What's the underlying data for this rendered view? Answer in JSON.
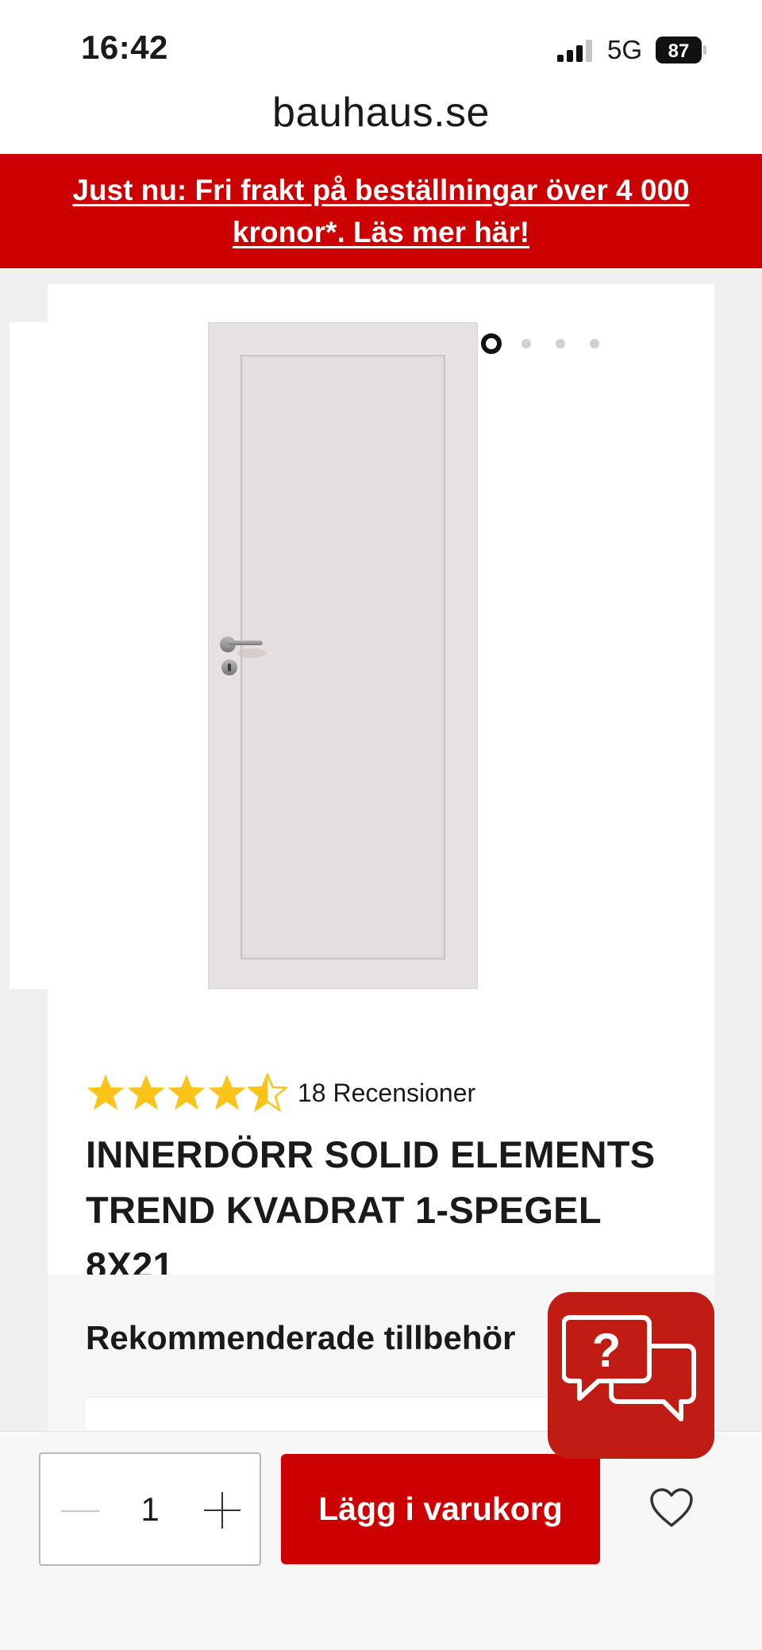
{
  "status_bar": {
    "time": "16:42",
    "network": "5G",
    "battery": "87"
  },
  "browser": {
    "url": "bauhaus.se"
  },
  "promo": {
    "text": "Just nu: Fri frakt på beställningar över 4 000 kronor*. Läs mer här!"
  },
  "gallery": {
    "image_count": 4,
    "active_index": 0
  },
  "product": {
    "rating": 4.5,
    "rating_max": 5,
    "reviews_label": "18 Recensioner",
    "title": "INNERDÖRR SOLID ELEMENTS TREND KVADRAT 1-SPEGEL 8X21"
  },
  "recommended": {
    "title": "Rekommenderade tillbehör"
  },
  "purchase": {
    "quantity": "1",
    "add_to_cart_label": "Lägg i varukorg"
  },
  "colors": {
    "brand_red": "#cc0000",
    "chat_red": "#c01c14"
  },
  "icons": [
    "signal-icon",
    "battery-icon",
    "star-icon",
    "chat-help-icon",
    "minus-icon",
    "plus-icon",
    "heart-icon"
  ]
}
